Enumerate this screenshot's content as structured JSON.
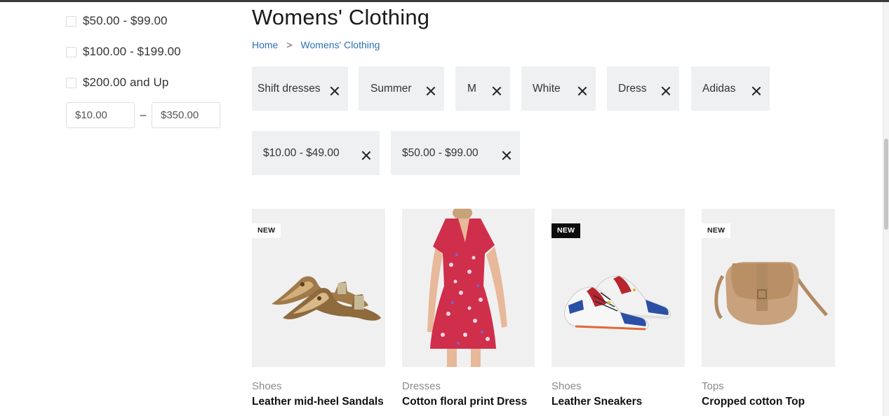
{
  "sidebar": {
    "price_options": [
      {
        "label": "$50.00 - $99.00"
      },
      {
        "label": "$100.00 - $199.00"
      },
      {
        "label": "$200.00 and Up"
      }
    ],
    "range_min": "$10.00",
    "range_max": "$350.00",
    "range_separator": "–"
  },
  "page": {
    "title": "Womens' Clothing",
    "breadcrumb": {
      "home": "Home",
      "separator": ">",
      "current": "Womens' Clothing"
    }
  },
  "filters": [
    {
      "label": "Shift dresses"
    },
    {
      "label": "Summer"
    },
    {
      "label": "M"
    },
    {
      "label": "White"
    },
    {
      "label": "Dress"
    },
    {
      "label": "Adidas"
    },
    {
      "label": "$10.00 - $49.00"
    },
    {
      "label": "$50.00 - $99.00"
    }
  ],
  "products": [
    {
      "badge": "NEW",
      "badge_style": "light",
      "category": "Shoes",
      "name": "Leather mid-heel Sandals",
      "icon": "sandals-image"
    },
    {
      "badge": "",
      "badge_style": "",
      "category": "Dresses",
      "name": "Cotton floral print Dress",
      "icon": "dress-image"
    },
    {
      "badge": "NEW",
      "badge_style": "dark",
      "category": "Shoes",
      "name": "Leather Sneakers",
      "icon": "sneakers-image"
    },
    {
      "badge": "NEW",
      "badge_style": "light",
      "category": "Tops",
      "name": "Cropped cotton Top",
      "icon": "bag-image"
    }
  ],
  "colors": {
    "link": "#2f6fb5",
    "chip_bg": "#eef0f2",
    "card_bg": "#f0f0f0"
  }
}
